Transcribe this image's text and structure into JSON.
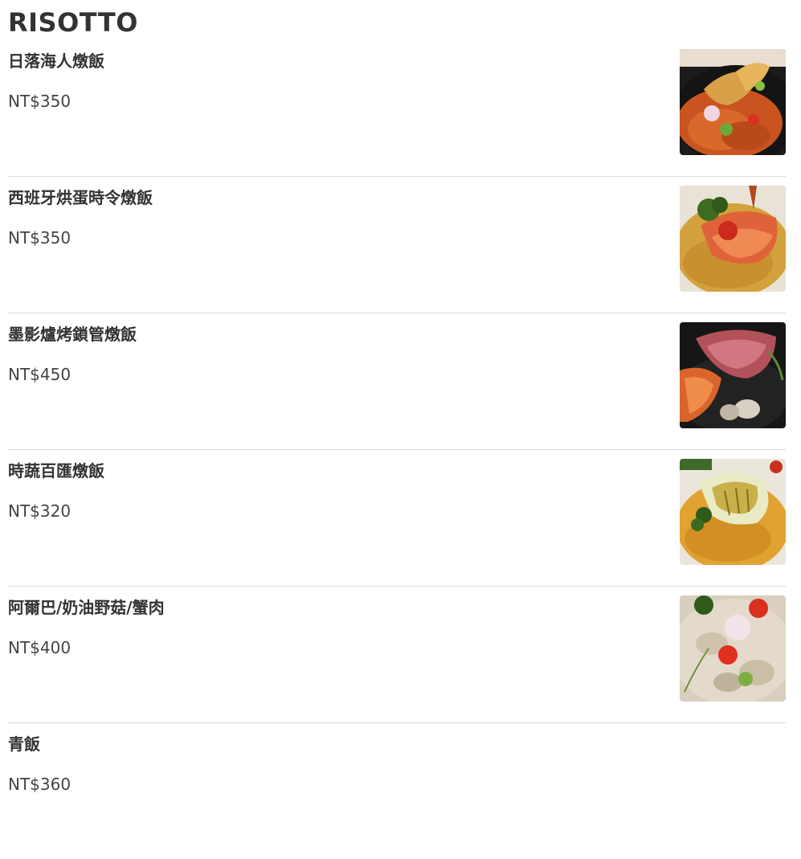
{
  "section": {
    "title": "RISOTTO"
  },
  "items": [
    {
      "name": "日落海人燉飯",
      "price": "NT$350",
      "photo": "sunset-seafood-risotto-photo"
    },
    {
      "name": "西班牙烘蛋時令燉飯",
      "price": "NT$350",
      "photo": "spanish-omelette-risotto-photo"
    },
    {
      "name": "墨影爐烤鎖管燉飯",
      "price": "NT$450",
      "photo": "squid-ink-grilled-squid-risotto-photo"
    },
    {
      "name": "時蔬百匯燉飯",
      "price": "NT$320",
      "photo": "vegetable-medley-risotto-photo"
    },
    {
      "name": "阿爾巴/奶油野菇/蟹肉",
      "price": "NT$400",
      "photo": "alba-mushroom-crab-risotto-photo"
    },
    {
      "name": "青飯",
      "price": "NT$360"
    }
  ]
}
